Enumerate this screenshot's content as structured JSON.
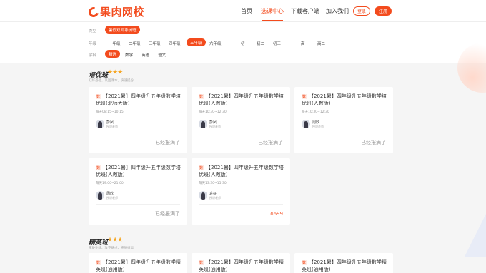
{
  "brand": {
    "name": "果肉网校",
    "color": "#f34b1d"
  },
  "nav": {
    "items": [
      "首页",
      "选课中心",
      "下载客户端",
      "加入我们"
    ],
    "active_index": 1,
    "login": "登录",
    "register": "注册"
  },
  "filters": {
    "type": {
      "label": "类型",
      "options": [
        "暑假双师系统班"
      ]
    },
    "grade": {
      "label": "年级",
      "options": [
        "一年级",
        "二年级",
        "三年级",
        "四年级",
        "五年级",
        "六年级",
        "初一",
        "初二",
        "初三",
        "高一",
        "高二"
      ],
      "selected": "五年级"
    },
    "subject": {
      "label": "学科",
      "options": [
        "精选",
        "数学",
        "英语",
        "语文"
      ],
      "selected": "精选"
    }
  },
  "sections": [
    {
      "title": "培优班",
      "stars": "★★★",
      "subtitle": "打好基础，巩固课本，快速提分",
      "cards": [
        {
          "tag": "数",
          "title": "【2021暑】四年级升五年级数学培优班(北师大版)",
          "time": "每天08:15~10:15",
          "teacher": "彭凤",
          "role": "授课老师",
          "status": "已经报满了"
        },
        {
          "tag": "数",
          "title": "【2021暑】四年级升五年级数学培优班(人教版)",
          "time": "每天10:30~12:30",
          "teacher": "彭凤",
          "role": "授课老师",
          "status": "已经报满了"
        },
        {
          "tag": "数",
          "title": "【2021暑】四年级升五年级数学培优班(人教版)",
          "time": "每天10:30~12:30",
          "teacher": "周欣",
          "role": "授课老师",
          "status": "已经报满了"
        },
        {
          "tag": "数",
          "title": "【2021暑】四年级升五年级数学培优班(人教版)",
          "time": "每天19:00~21:00",
          "teacher": "周欣",
          "role": "授课老师",
          "status": "已经报满了"
        },
        {
          "tag": "数",
          "title": "【2021暑】四年级升五年级数学培优班(人教版)",
          "time": "每天13:30~15:30",
          "teacher": "袁征",
          "role": "授课老师",
          "price": "¥699"
        }
      ]
    },
    {
      "title": "精英班",
      "stars": "★★★",
      "subtitle": "重难补缺、攻克难点、拓层拔高",
      "cards": [
        {
          "tag": "数",
          "title": "【2021暑】四年级升五年级数学精英班(通用版)"
        },
        {
          "tag": "数",
          "title": "【2021暑】四年级升五年级数学精英班(通用版)"
        },
        {
          "tag": "数",
          "title": "【2021暑】四年级升五年级数学精英班(通用版)"
        }
      ]
    }
  ]
}
